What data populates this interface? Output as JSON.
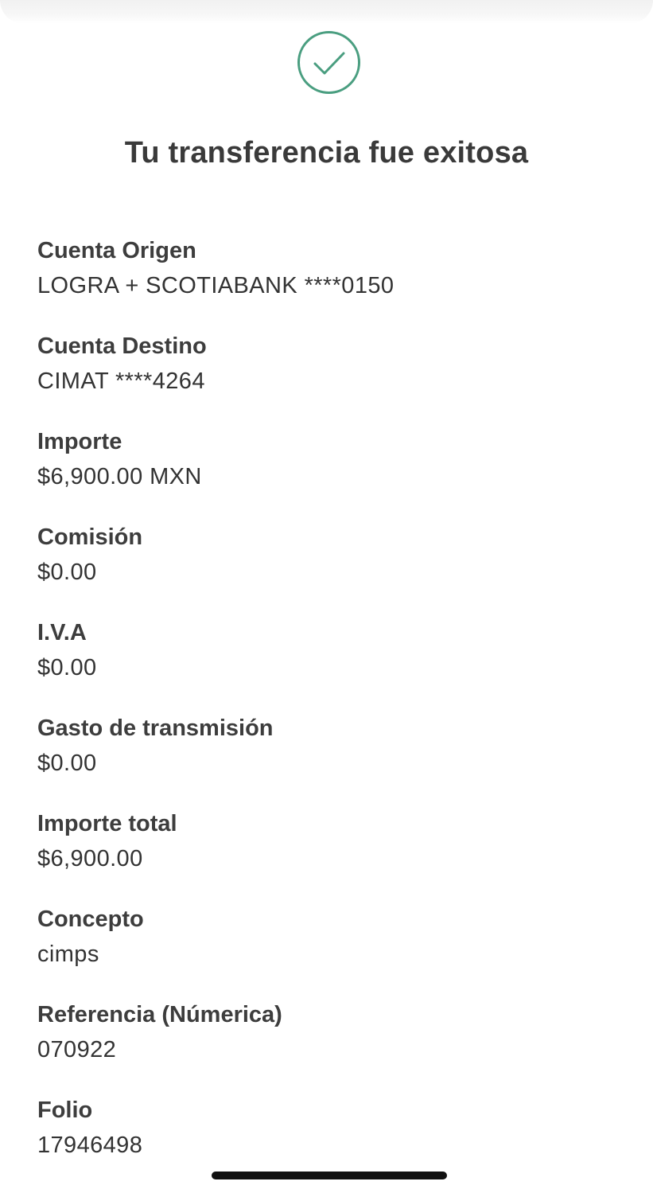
{
  "status": {
    "icon": "check-circle-icon",
    "accent_color": "#4a9e80",
    "title": "Tu transferencia fue exitosa"
  },
  "details": [
    {
      "label": "Cuenta Origen",
      "value": "LOGRA + SCOTIABANK ****0150"
    },
    {
      "label": "Cuenta Destino",
      "value": "CIMAT ****4264"
    },
    {
      "label": "Importe",
      "value": "$6,900.00 MXN"
    },
    {
      "label": "Comisión",
      "value": "$0.00"
    },
    {
      "label": "I.V.A",
      "value": "$0.00"
    },
    {
      "label": "Gasto de transmisión",
      "value": "$0.00"
    },
    {
      "label": "Importe total",
      "value": "$6,900.00"
    },
    {
      "label": "Concepto",
      "value": "cimps"
    },
    {
      "label": "Referencia (Númerica)",
      "value": "070922"
    },
    {
      "label": "Folio",
      "value": "17946498"
    }
  ]
}
